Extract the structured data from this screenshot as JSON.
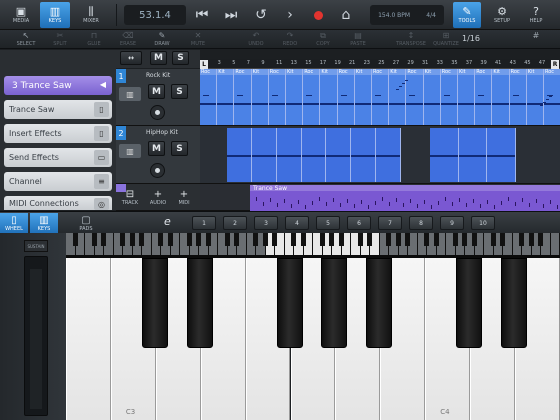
{
  "topbar": {
    "media_label": "MEDIA",
    "keys_label": "KEYS",
    "mixer_label": "MIXER",
    "position": "53.1.4",
    "tempo": "154.0 BPM",
    "signature": "4/4",
    "tools_label": "TOOLS",
    "setup_label": "SETUP",
    "help_label": "HELP"
  },
  "editbar": {
    "select": "SELECT",
    "split": "SPLIT",
    "glue": "GLUE",
    "erase": "ERASE",
    "draw": "DRAW",
    "mute": "MUTE",
    "undo": "UNDO",
    "redo": "REDO",
    "copy": "COPY",
    "paste": "PASTE",
    "transpose": "TRANSPOSE",
    "quantize": "QUANTIZE",
    "grid": "1/16"
  },
  "inspector": {
    "selected_track": "3  Trance Saw",
    "items": [
      "Trance Saw",
      "Insert Effects",
      "Send Effects",
      "Channel",
      "MIDI Connections"
    ]
  },
  "ruler": {
    "left_marker": "L",
    "right_marker": "R",
    "bars": [
      "1",
      "3",
      "5",
      "7",
      "9",
      "11",
      "13",
      "15",
      "17",
      "19",
      "21",
      "23",
      "25",
      "27",
      "29",
      "31",
      "33",
      "35",
      "37",
      "39",
      "41",
      "43",
      "45",
      "47"
    ]
  },
  "tracks": [
    {
      "number": "1",
      "name": "Rock Kit",
      "mute": "M",
      "solo": "S"
    },
    {
      "number": "2",
      "name": "HipHop Kit",
      "mute": "M",
      "solo": "S"
    },
    {
      "number": "3",
      "name": "Trance Saw"
    }
  ],
  "clips": {
    "rock_labels": [
      "Roc",
      "Kit",
      "Roc",
      "Kit",
      "Roc",
      "Kit",
      "Roc",
      "Kit",
      "Roc",
      "Kit",
      "Roc",
      "Kit",
      "Roc",
      "Kit",
      "Roc",
      "Kit",
      "Roc",
      "Kit",
      "Roc",
      "Kit",
      "Roc"
    ],
    "trance_label": "Trance Saw"
  },
  "track_controls": {
    "track": "TRACK",
    "audio": "AUDIO",
    "midi": "MIDI"
  },
  "keyboard_bar": {
    "wheel": "WHEEL",
    "keys": "KEYS",
    "pads": "PADS",
    "octaves": [
      "1",
      "2",
      "3",
      "4",
      "5",
      "6",
      "7",
      "8",
      "9",
      "10"
    ],
    "sustain": "SUSTAIN"
  },
  "keyboard": {
    "c3_label": "C3",
    "c4_label": "C4"
  },
  "colors": {
    "accent_blue": "#2f86d6",
    "selected_purple": "#8a73de",
    "clip_blue": "#3f6fdf",
    "record_red": "#e2342f"
  }
}
